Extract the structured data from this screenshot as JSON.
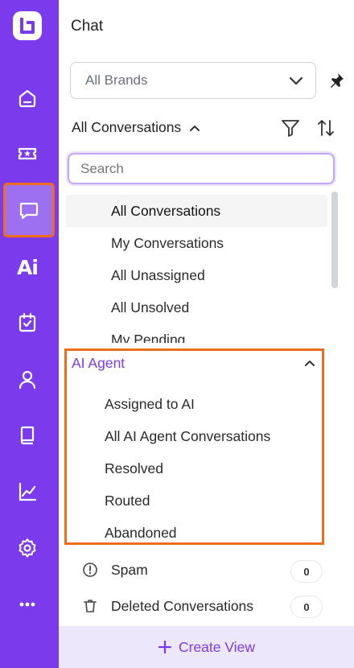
{
  "panel": {
    "title": "Chat",
    "brand_select": {
      "value": "All Brands"
    },
    "conversations_header": "All Conversations"
  },
  "dropdown": {
    "search_placeholder": "Search",
    "items": [
      {
        "label": "All Conversations"
      },
      {
        "label": "My Conversations"
      },
      {
        "label": "All Unassigned"
      },
      {
        "label": "All Unsolved"
      },
      {
        "label": "My Pending"
      }
    ],
    "ai_section": {
      "title": "AI Agent",
      "items": [
        {
          "label": "Assigned to AI"
        },
        {
          "label": "All AI Agent Conversations"
        },
        {
          "label": "Resolved"
        },
        {
          "label": "Routed"
        },
        {
          "label": "Abandoned"
        }
      ]
    }
  },
  "bottom": {
    "spam": {
      "label": "Spam",
      "count": "0"
    },
    "deleted": {
      "label": "Deleted Conversations",
      "count": "0"
    },
    "create_view": "Create View"
  },
  "rail": {
    "ai_label": "Ai",
    "icons": [
      "home-icon",
      "ticket-icon",
      "chat-icon",
      "ai-icon",
      "calendar-check-icon",
      "user-icon",
      "book-icon",
      "chart-icon",
      "settings-icon",
      "more-icon"
    ]
  },
  "colors": {
    "accent": "#7c3aed",
    "highlight": "#ef6c1a"
  }
}
